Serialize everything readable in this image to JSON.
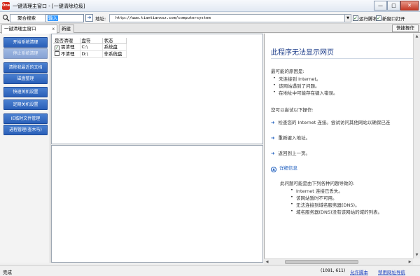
{
  "window": {
    "app_icon_text": "One",
    "title": "一键清理主窗口 - [一键清除垃圾]",
    "min": "—",
    "max": "□",
    "close": "✕"
  },
  "toolbar": {
    "engine": "聚合搜索",
    "search_value": "输入",
    "go": "➜",
    "address_label": "地址:",
    "address_value": "http://www.tiantianxsz.com/computersystem",
    "option_script": "运行脚本",
    "option_newwin": "新窗口打开"
  },
  "tabs": {
    "active": "一键清理主窗口",
    "close": "x",
    "new": "新建",
    "quick": "快捷操作"
  },
  "sidebar": {
    "buttons": [
      {
        "label": "开始系统清理",
        "enabled": true
      },
      {
        "label": "停止系统清理",
        "enabled": false
      },
      {
        "label": "清除我最近的文档",
        "enabled": true
      },
      {
        "label": "磁盘整理",
        "enabled": true
      },
      {
        "label": "快速关机设置",
        "enabled": true
      },
      {
        "label": "定期关机设置",
        "enabled": true
      },
      {
        "label": "IE临时文件管理",
        "enabled": true
      },
      {
        "label": "进程管理(查木马)",
        "enabled": true
      }
    ]
  },
  "table": {
    "headers": [
      "是否清理",
      "盘符",
      "状态"
    ],
    "rows": [
      {
        "checked": true,
        "clean": "需清理",
        "drive": "C:\\",
        "status": "系统盘"
      },
      {
        "checked": false,
        "clean": "不清理",
        "drive": "D:\\",
        "status": "非系统盘"
      }
    ]
  },
  "browser": {
    "heading": "此程序无法显示网页",
    "causes_title": "最可能的原因是:",
    "causes": [
      "未连接到 Internet。",
      "该网站遇到了问题。",
      "在地址中可能存在键入错误。"
    ],
    "try_title": "您可以尝试以下操作:",
    "actions": [
      "检查您的 Internet 连接。尝试访问其他网站以确保已连",
      "重新键入地址。",
      "返回到上一页。"
    ],
    "details_toggle": "详细信息",
    "details_title": "此问题可能是由下列各种问题导致的:",
    "details": [
      "Internet 连接已丢失。",
      "该网站暂时不可用。",
      "无法连接到域名服务器(DNS)。",
      "域名服务器(DNS)没有该网站的域的列表。"
    ]
  },
  "status": {
    "text": "完成",
    "coords": "(1091, 611)",
    "link_script": "允许脚本",
    "link_nav": "禁用网址导航"
  }
}
